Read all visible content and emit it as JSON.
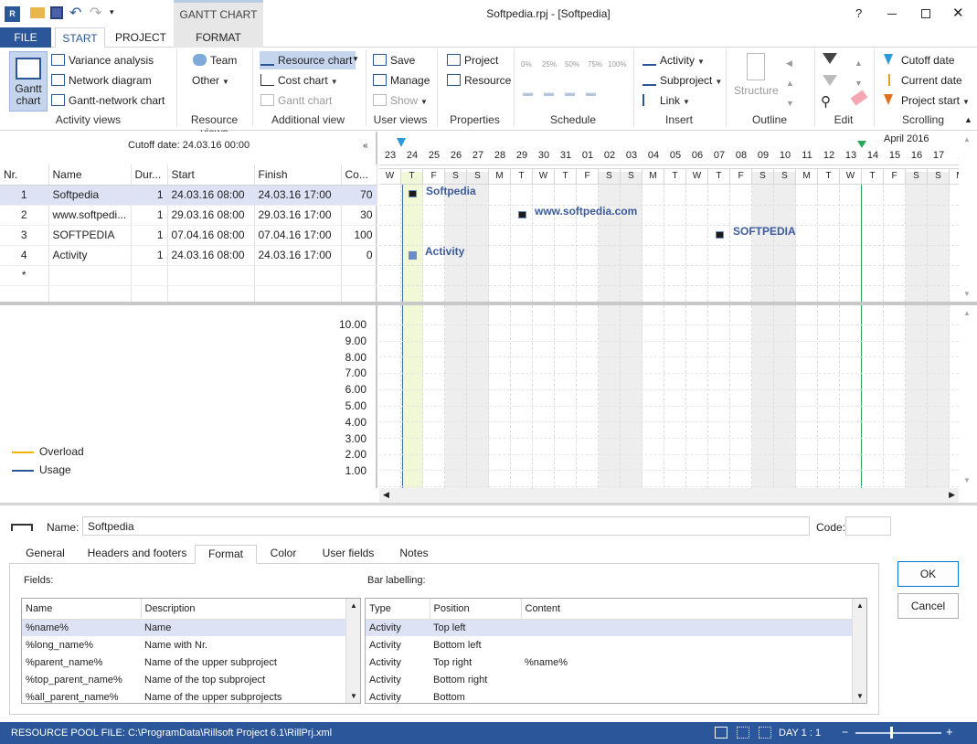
{
  "window": {
    "title": "Softpedia.rpj - [Softpedia]",
    "context_tab": "GANTT CHART"
  },
  "ribbon_tabs": [
    "FILE",
    "START",
    "PROJECT",
    "FORMAT"
  ],
  "ribbon": {
    "activity_views": {
      "label": "Activity views",
      "gantt": "Gantt chart",
      "items": [
        "Variance analysis",
        "Network diagram",
        "Gantt-network chart"
      ]
    },
    "resource_views": {
      "label": "Resource views",
      "items": [
        "Team",
        "Other"
      ]
    },
    "additional_view": {
      "label": "Additional view",
      "items": [
        "Resource chart",
        "Cost chart",
        "Gantt chart"
      ]
    },
    "user_views": {
      "label": "User views",
      "items": [
        "Save",
        "Manage",
        "Show"
      ]
    },
    "properties": {
      "label": "Properties",
      "items": [
        "Project",
        "Resource"
      ]
    },
    "schedule": {
      "label": "Schedule",
      "percents": [
        "0%",
        "25%",
        "50%",
        "75%",
        "100%"
      ]
    },
    "insert": {
      "label": "Insert",
      "items": [
        "Activity",
        "Subproject",
        "Link"
      ]
    },
    "outline": {
      "label": "Outline",
      "structure": "Structure"
    },
    "edit": {
      "label": "Edit"
    },
    "scrolling": {
      "label": "Scrolling",
      "items": [
        "Cutoff date",
        "Current date",
        "Project start"
      ]
    }
  },
  "cutoff": "Cutoff date: 24.03.16 00:00",
  "table": {
    "headers": [
      "Nr.",
      "Name",
      "Dur...",
      "Start",
      "Finish",
      "Co..."
    ],
    "rows": [
      {
        "nr": "1",
        "name": "Softpedia",
        "dur": "1",
        "start": "24.03.16 08:00",
        "finish": "24.03.16 17:00",
        "co": "70"
      },
      {
        "nr": "2",
        "name": "www.softpedi...",
        "dur": "1",
        "start": "29.03.16 08:00",
        "finish": "29.03.16 17:00",
        "co": "30"
      },
      {
        "nr": "3",
        "name": "SOFTPEDIA",
        "dur": "1",
        "start": "07.04.16 08:00",
        "finish": "07.04.16 17:00",
        "co": "100"
      },
      {
        "nr": "4",
        "name": "Activity",
        "dur": "1",
        "start": "24.03.16 08:00",
        "finish": "24.03.16 17:00",
        "co": "0"
      }
    ],
    "new_row": "*"
  },
  "timeline": {
    "month": "April 2016",
    "days": [
      "23",
      "24",
      "25",
      "26",
      "27",
      "28",
      "29",
      "30",
      "31",
      "01",
      "02",
      "03",
      "04",
      "05",
      "06",
      "07",
      "08",
      "09",
      "10",
      "11",
      "12",
      "13",
      "14",
      "15",
      "16",
      "17",
      "1"
    ],
    "weekdays": [
      "W",
      "T",
      "F",
      "S",
      "S",
      "M",
      "T",
      "W",
      "T",
      "F",
      "S",
      "S",
      "M",
      "T",
      "W",
      "T",
      "F",
      "S",
      "S",
      "M",
      "T",
      "W",
      "T",
      "F",
      "S",
      "S",
      "M"
    ],
    "bar_labels": [
      "Softpedia",
      "www.softpedia.com",
      "SOFTPEDIA",
      "Activity"
    ]
  },
  "resource_chart": {
    "y_ticks": [
      "10.00",
      "9.00",
      "8.00",
      "7.00",
      "6.00",
      "5.00",
      "4.00",
      "3.00",
      "2.00",
      "1.00"
    ],
    "legend": [
      {
        "name": "Overload",
        "color": "#f0b400"
      },
      {
        "name": "Usage",
        "color": "#2b579a"
      }
    ]
  },
  "details": {
    "name_label": "Name:",
    "name_value": "Softpedia",
    "code_label": "Code:",
    "code_value": "",
    "tabs": [
      "General",
      "Headers and footers",
      "Format",
      "Color",
      "User fields",
      "Notes"
    ],
    "fields_label": "Fields:",
    "bar_label": "Bar labelling:",
    "fields_headers": [
      "Name",
      "Description"
    ],
    "fields_rows": [
      [
        "%name%",
        "Name"
      ],
      [
        "%long_name%",
        "Name with Nr."
      ],
      [
        "%parent_name%",
        "Name of the upper subproject"
      ],
      [
        "%top_parent_name%",
        "Name of the top subproject"
      ],
      [
        "%all_parent_name%",
        "Name of the upper subprojects"
      ]
    ],
    "bar_headers": [
      "Type",
      "Position",
      "Content"
    ],
    "bar_rows": [
      [
        "Activity",
        "Top left",
        ""
      ],
      [
        "Activity",
        "Bottom left",
        ""
      ],
      [
        "Activity",
        "Top right",
        "%name%"
      ],
      [
        "Activity",
        "Bottom right",
        ""
      ],
      [
        "Activity",
        "Bottom",
        ""
      ]
    ],
    "ok": "OK",
    "cancel": "Cancel"
  },
  "status": {
    "file": "RESOURCE POOL FILE: C:\\ProgramData\\Rillsoft Project 6.1\\RillPrj.xml",
    "zoom": "DAY 1 : 1"
  },
  "colors": {
    "accent": "#2b579a",
    "selected_row": "#dde3f4",
    "weekend": "#eeeeee",
    "today_col": "#f0f8d8"
  }
}
